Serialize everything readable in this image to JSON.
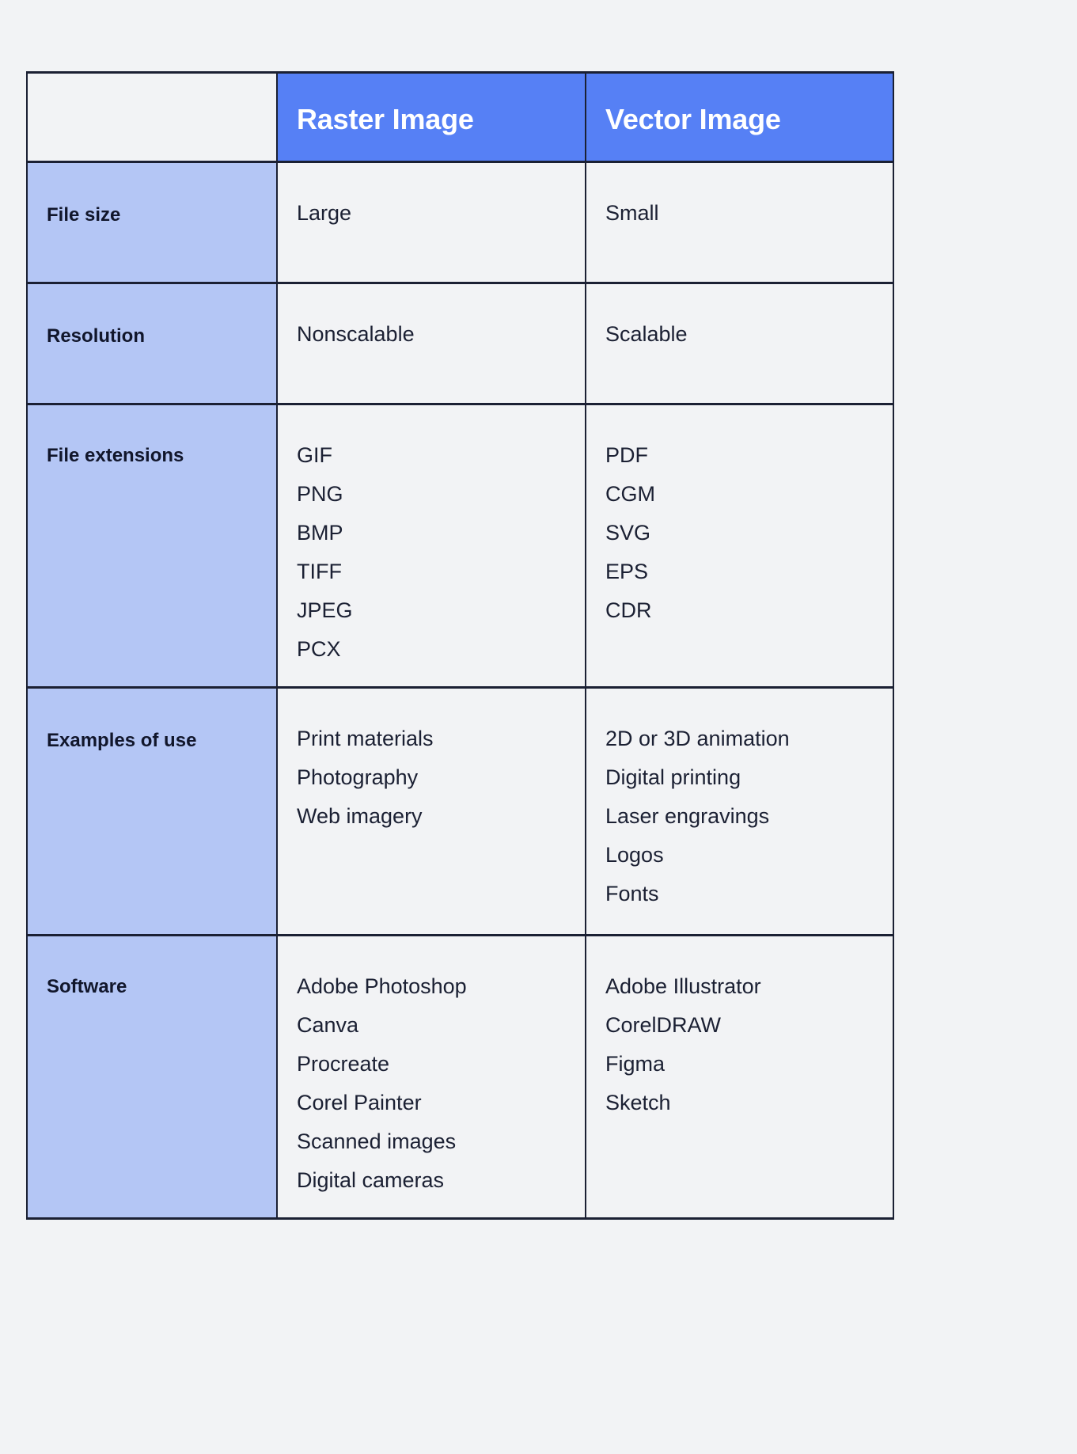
{
  "page": {
    "background_color": "#f2f3f5",
    "text_color": "#1b2033",
    "border_color": "#1b2033"
  },
  "table": {
    "header_accent_color": "#5680f5",
    "label_column_color": "#b4c6f5",
    "columns": [
      {
        "key": "label",
        "label": ""
      },
      {
        "key": "raster",
        "label": "Raster Image"
      },
      {
        "key": "vector",
        "label": "Vector Image"
      }
    ],
    "rows": [
      {
        "label": "File size",
        "raster": [
          "Large"
        ],
        "vector": [
          "Small"
        ]
      },
      {
        "label": "Resolution",
        "raster": [
          "Nonscalable"
        ],
        "vector": [
          "Scalable"
        ]
      },
      {
        "label": "File extensions",
        "raster": [
          "GIF",
          "PNG",
          "BMP",
          "TIFF",
          "JPEG",
          "PCX"
        ],
        "vector": [
          "PDF",
          "CGM",
          "SVG",
          "EPS",
          "CDR"
        ]
      },
      {
        "label": "Examples of use",
        "raster": [
          "Print materials",
          "Photography",
          "Web imagery"
        ],
        "vector": [
          "2D or 3D animation",
          "Digital printing",
          "Laser engravings",
          "Logos",
          "Fonts"
        ]
      },
      {
        "label": "Software",
        "raster": [
          "Adobe Photoshop",
          "Canva",
          "Procreate",
          "Corel Painter",
          "Scanned images",
          "Digital cameras"
        ],
        "vector": [
          "Adobe Illustrator",
          "CorelDRAW",
          "Figma",
          "Sketch"
        ]
      }
    ]
  }
}
